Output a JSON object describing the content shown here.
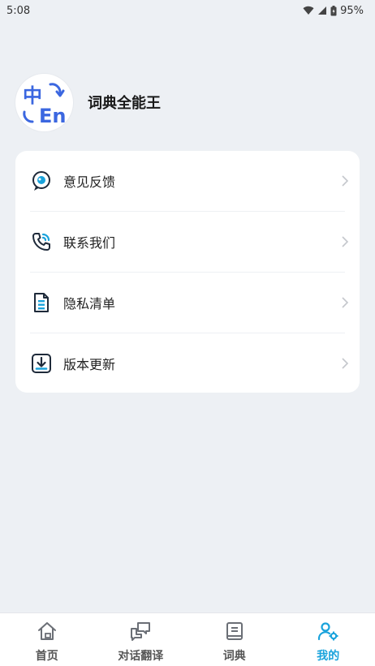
{
  "status_bar": {
    "time": "5:08",
    "battery": "95%",
    "icons": [
      "wifi-icon",
      "signal-icon",
      "battery-icon"
    ]
  },
  "profile": {
    "avatar_icon": "translate-zh-en-icon",
    "avatar_glyph_top": "中",
    "avatar_glyph_bottom": "En",
    "app_name": "词典全能王"
  },
  "menu": {
    "items": [
      {
        "label": "意见反馈",
        "icon": "feedback-icon"
      },
      {
        "label": "联系我们",
        "icon": "phone-icon"
      },
      {
        "label": "隐私清单",
        "icon": "privacy-list-icon"
      },
      {
        "label": "版本更新",
        "icon": "update-download-icon"
      }
    ]
  },
  "tabbar": {
    "tabs": [
      {
        "label": "首页",
        "icon": "home-icon",
        "active": false
      },
      {
        "label": "对话翻译",
        "icon": "conversation-icon",
        "active": false
      },
      {
        "label": "词典",
        "icon": "dictionary-book-icon",
        "active": false
      },
      {
        "label": "我的",
        "icon": "profile-settings-icon",
        "active": true
      }
    ]
  },
  "colors": {
    "accent": "#1aa3dc",
    "background": "#edf0f4",
    "card": "#ffffff",
    "brand_blue": "#3b67e0"
  }
}
